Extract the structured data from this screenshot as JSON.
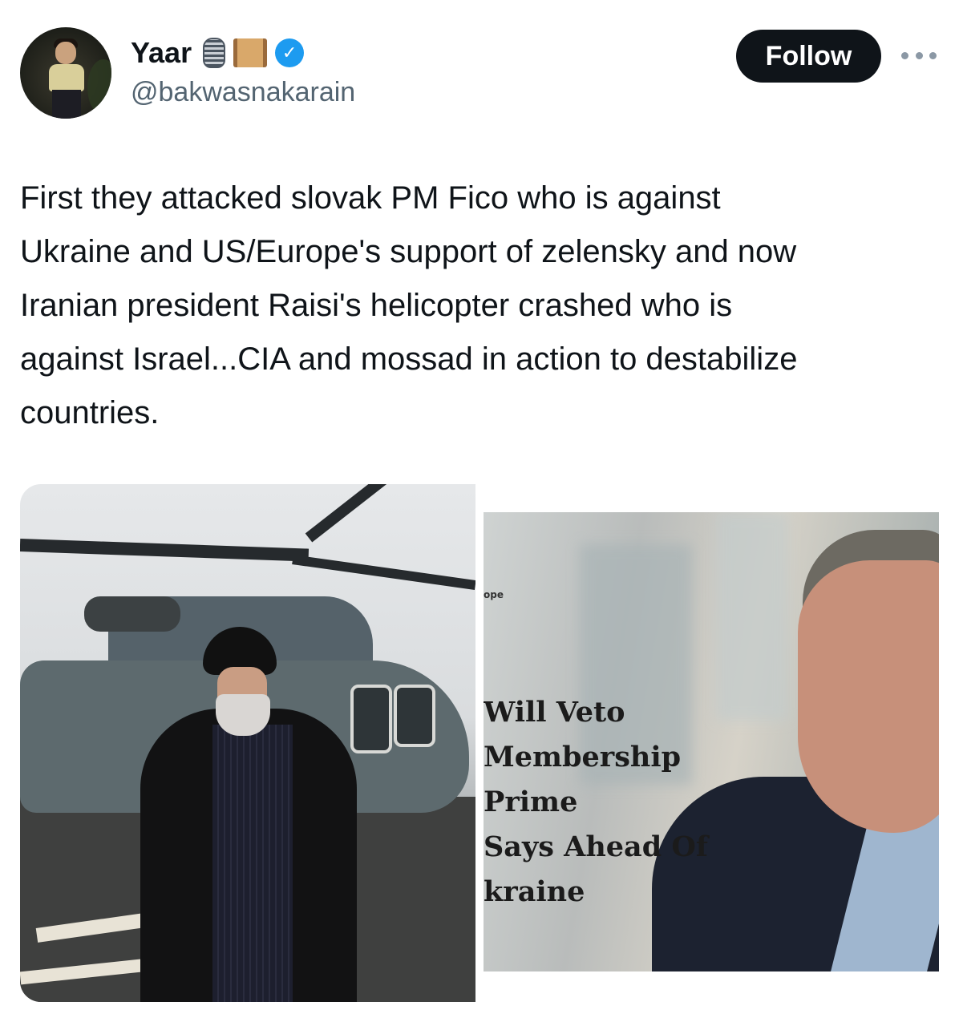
{
  "author": {
    "display_name": "Yaar",
    "name_emojis": [
      "studio-microphone-icon",
      "scroll-icon"
    ],
    "verified": true,
    "verified_color": "#1d9bf0",
    "handle": "@bakwasnakarain"
  },
  "actions": {
    "follow_label": "Follow",
    "more_icon": "more-horizontal-icon"
  },
  "tweet": {
    "text": "First they attacked slovak PM Fico who is against\nUkraine and US/Europe's support of zelensky and now\nIranian president Raisi's helicopter crashed who is\nagainst Israel...CIA and mossad in action to destabilize\ncountries."
  },
  "media": {
    "image_right": {
      "corner_text": "ope",
      "headline_lines": [
        "Will Veto",
        " Membership",
        "Prime",
        "Says Ahead Of",
        "kraine"
      ]
    }
  },
  "colors": {
    "text_primary": "#0f1419",
    "text_secondary": "#536471",
    "follow_bg": "#0f1419",
    "follow_text": "#ffffff"
  }
}
